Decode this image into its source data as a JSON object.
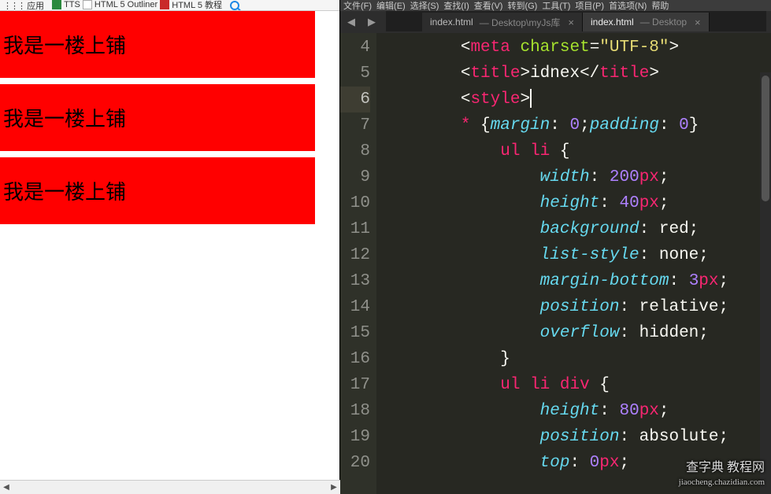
{
  "browser": {
    "apps_label": "应用",
    "bookmarks": [
      {
        "icon": "green",
        "label": "TTS"
      },
      {
        "icon": "blank",
        "label": "HTML 5 Outliner"
      },
      {
        "icon": "red",
        "label": "HTML 5 教程"
      }
    ]
  },
  "page": {
    "list_items": [
      "我是一楼上铺",
      "我是一楼上铺",
      "我是一楼上铺"
    ]
  },
  "editor": {
    "menubar": [
      {
        "hot": "",
        "rest": "文件(F)"
      },
      {
        "hot": "",
        "rest": "编辑(E)"
      },
      {
        "hot": "",
        "rest": "选择(S)"
      },
      {
        "hot": "",
        "rest": "查找(I)"
      },
      {
        "hot": "",
        "rest": "查看(V)"
      },
      {
        "hot": "",
        "rest": "转到(G)"
      },
      {
        "hot": "",
        "rest": "工具(T)"
      },
      {
        "hot": "",
        "rest": "项目(P)"
      },
      {
        "hot": "",
        "rest": "首选项(N)"
      },
      {
        "hot": "",
        "rest": "帮助"
      }
    ],
    "tabs": [
      {
        "name": "index.html",
        "path": " — Desktop\\myJs库",
        "active": false
      },
      {
        "name": "index.html",
        "path": " — Desktop",
        "active": true
      }
    ],
    "first_line_no": 4,
    "active_line_no": 6,
    "lines": [
      {
        "indent": 2,
        "tokens": [
          {
            "c": "p",
            "t": "<"
          },
          {
            "c": "t",
            "t": "meta"
          },
          {
            "c": "p",
            "t": " "
          },
          {
            "c": "an",
            "t": "charset"
          },
          {
            "c": "p",
            "t": "="
          },
          {
            "c": "s",
            "t": "\"UTF-8\""
          },
          {
            "c": "p",
            "t": ">"
          }
        ]
      },
      {
        "indent": 2,
        "tokens": [
          {
            "c": "p",
            "t": "<"
          },
          {
            "c": "t",
            "t": "title"
          },
          {
            "c": "p",
            "t": ">"
          },
          {
            "c": "p",
            "t": "idnex"
          },
          {
            "c": "p",
            "t": "</"
          },
          {
            "c": "t",
            "t": "title"
          },
          {
            "c": "p",
            "t": ">"
          }
        ]
      },
      {
        "indent": 2,
        "cursor_after": true,
        "tokens": [
          {
            "c": "p",
            "t": "<"
          },
          {
            "c": "t",
            "t": "style"
          },
          {
            "c": "p",
            "t": ">"
          }
        ]
      },
      {
        "indent": 2,
        "tokens": [
          {
            "c": "t",
            "t": "*"
          },
          {
            "c": "p",
            "t": " {"
          },
          {
            "c": "pr",
            "t": "margin"
          },
          {
            "c": "p",
            "t": ": "
          },
          {
            "c": "nm",
            "t": "0"
          },
          {
            "c": "p",
            "t": ";"
          },
          {
            "c": "pr",
            "t": "padding"
          },
          {
            "c": "p",
            "t": ": "
          },
          {
            "c": "nm",
            "t": "0"
          },
          {
            "c": "p",
            "t": "}"
          }
        ]
      },
      {
        "indent": 3,
        "tokens": [
          {
            "c": "t",
            "t": "ul"
          },
          {
            "c": "p",
            "t": " "
          },
          {
            "c": "t",
            "t": "li"
          },
          {
            "c": "p",
            "t": " {"
          }
        ]
      },
      {
        "indent": 4,
        "tokens": [
          {
            "c": "pr",
            "t": "width"
          },
          {
            "c": "p",
            "t": ": "
          },
          {
            "c": "nm",
            "t": "200"
          },
          {
            "c": "un",
            "t": "px"
          },
          {
            "c": "p",
            "t": ";"
          }
        ]
      },
      {
        "indent": 4,
        "tokens": [
          {
            "c": "pr",
            "t": "height"
          },
          {
            "c": "p",
            "t": ": "
          },
          {
            "c": "nm",
            "t": "40"
          },
          {
            "c": "un",
            "t": "px"
          },
          {
            "c": "p",
            "t": ";"
          }
        ]
      },
      {
        "indent": 4,
        "tokens": [
          {
            "c": "pr",
            "t": "background"
          },
          {
            "c": "p",
            "t": ": red;"
          }
        ]
      },
      {
        "indent": 4,
        "tokens": [
          {
            "c": "pr",
            "t": "list-style"
          },
          {
            "c": "p",
            "t": ": none;"
          }
        ]
      },
      {
        "indent": 4,
        "tokens": [
          {
            "c": "pr",
            "t": "margin-bottom"
          },
          {
            "c": "p",
            "t": ": "
          },
          {
            "c": "nm",
            "t": "3"
          },
          {
            "c": "un",
            "t": "px"
          },
          {
            "c": "p",
            "t": ";"
          }
        ]
      },
      {
        "indent": 4,
        "tokens": [
          {
            "c": "pr",
            "t": "position"
          },
          {
            "c": "p",
            "t": ": relative;"
          }
        ]
      },
      {
        "indent": 4,
        "tokens": [
          {
            "c": "pr",
            "t": "overflow"
          },
          {
            "c": "p",
            "t": ": hidden;"
          }
        ]
      },
      {
        "indent": 3,
        "tokens": [
          {
            "c": "p",
            "t": "}"
          }
        ]
      },
      {
        "indent": 3,
        "tokens": [
          {
            "c": "t",
            "t": "ul"
          },
          {
            "c": "p",
            "t": " "
          },
          {
            "c": "t",
            "t": "li"
          },
          {
            "c": "p",
            "t": " "
          },
          {
            "c": "t",
            "t": "div"
          },
          {
            "c": "p",
            "t": " {"
          }
        ]
      },
      {
        "indent": 4,
        "tokens": [
          {
            "c": "pr",
            "t": "height"
          },
          {
            "c": "p",
            "t": ": "
          },
          {
            "c": "nm",
            "t": "80"
          },
          {
            "c": "un",
            "t": "px"
          },
          {
            "c": "p",
            "t": ";"
          }
        ]
      },
      {
        "indent": 4,
        "tokens": [
          {
            "c": "pr",
            "t": "position"
          },
          {
            "c": "p",
            "t": ": absolute;"
          }
        ]
      },
      {
        "indent": 4,
        "tokens": [
          {
            "c": "pr",
            "t": "top"
          },
          {
            "c": "p",
            "t": ": "
          },
          {
            "c": "nm",
            "t": "0"
          },
          {
            "c": "un",
            "t": "px"
          },
          {
            "c": "p",
            "t": ";"
          }
        ]
      }
    ]
  },
  "watermark": {
    "line1": "查字典 教程网",
    "line2": "jiaocheng.chazidian.com"
  }
}
